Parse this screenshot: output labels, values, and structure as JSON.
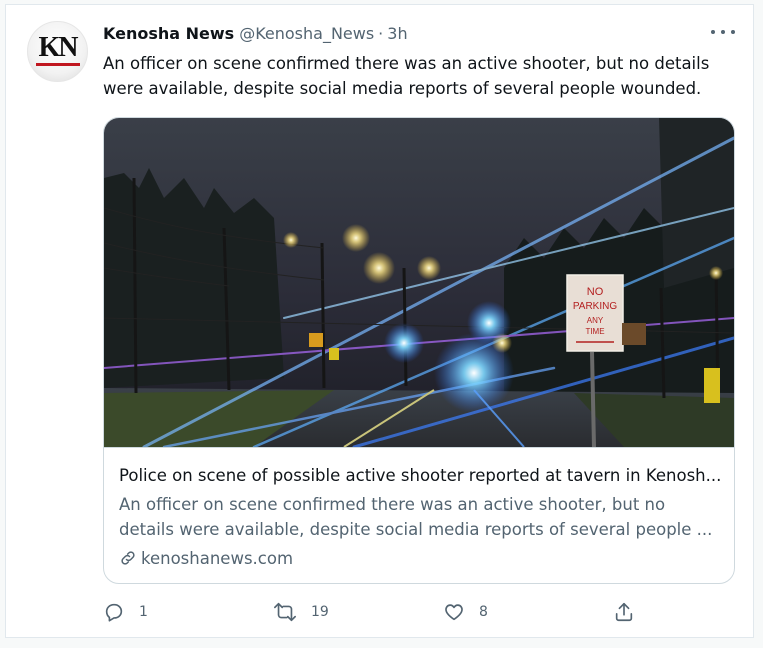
{
  "tweet": {
    "display_name": "Kenosha News",
    "handle": "@Kenosha_News",
    "separator": "·",
    "time": "3h",
    "avatar_text": "KN",
    "text_line1": "An officer on scene confirmed there was an active shooter, but no details",
    "text_line2": "were available, despite social media reports of several people wounded."
  },
  "card": {
    "title": "Police on scene of possible active shooter reported at tavern in Kenosh...",
    "desc_line1": "An officer on scene confirmed there was an active shooter, but no",
    "desc_line2": "details were available, despite social media reports of several people ...",
    "domain": "kenoshanews.com",
    "sign_text": "NO PARKING ANY TIME"
  },
  "actions": {
    "reply_count": "1",
    "retweet_count": "19",
    "like_count": "8"
  },
  "colors": {
    "text": "#0f1419",
    "secondary": "#536471",
    "border": "#cfd9de",
    "brand_red": "#c0161f"
  },
  "icons": [
    "more-icon",
    "link-icon",
    "reply-icon",
    "retweet-icon",
    "like-icon",
    "share-icon"
  ]
}
